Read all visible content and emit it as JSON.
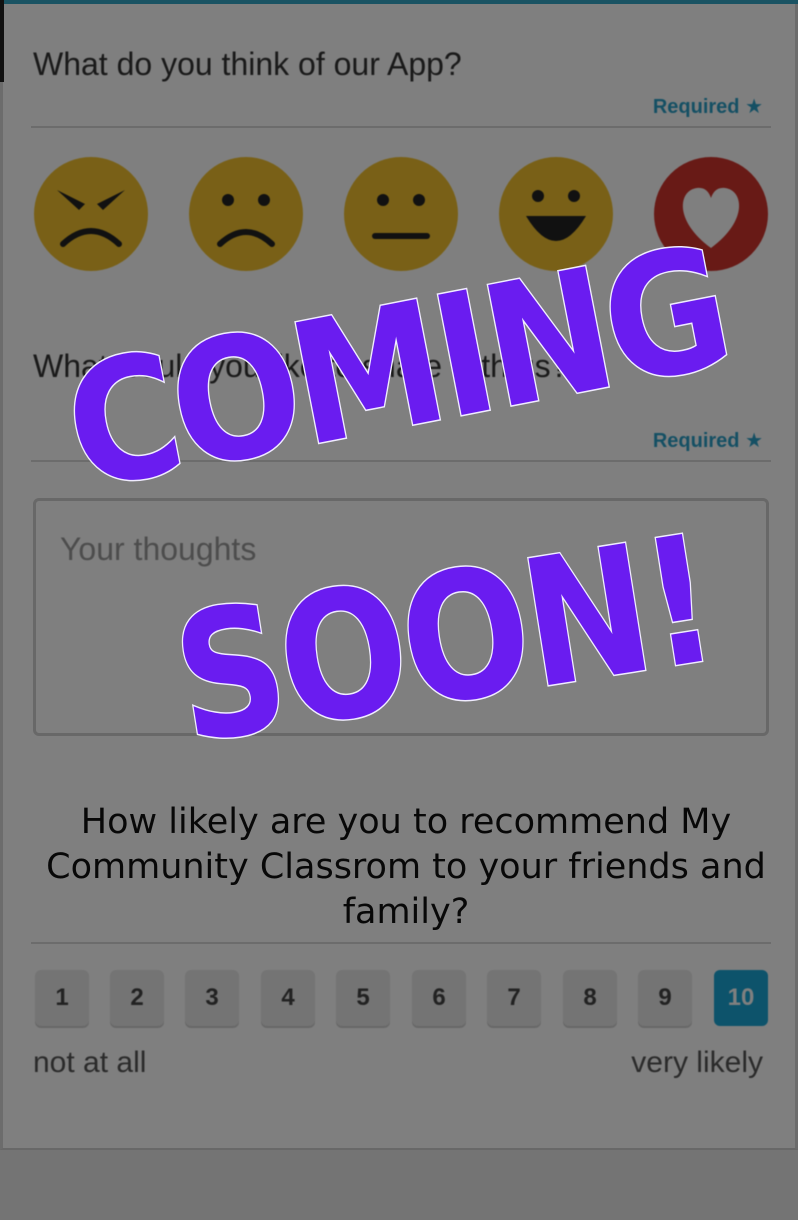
{
  "q1": {
    "text": "What do you think of our App?",
    "required": "Required ★"
  },
  "faces": [
    "angry-face-icon",
    "sad-face-icon",
    "neutral-face-icon",
    "happy-face-icon",
    "heart-icon"
  ],
  "q2": {
    "text": "What would you like to share with us?",
    "required": "Required ★"
  },
  "thoughts": {
    "placeholder": "Your thoughts"
  },
  "q3": {
    "line1": "How likely are you to recommend My",
    "line2": "Community Classrom to your friends and family?"
  },
  "scale": {
    "numbers": [
      "1",
      "2",
      "3",
      "4",
      "5",
      "6",
      "7",
      "8",
      "9",
      "10"
    ],
    "selected": "10",
    "low_label": "not at all",
    "high_label": "very likely"
  },
  "overlay": {
    "line1": "COMING",
    "line2": "SOON!"
  },
  "colors": {
    "accent": "#1aa6d6",
    "face_yellow": "#f2c12e",
    "heart_red": "#d0342c",
    "overlay_text": "#6a1cf0"
  }
}
